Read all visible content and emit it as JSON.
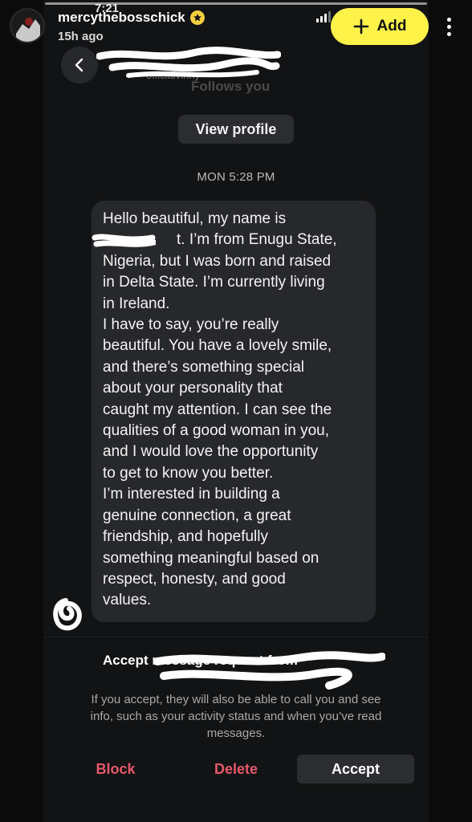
{
  "story_header": {
    "username": "mercythebosschick",
    "posted_ago": "15h ago",
    "status_time": "7:21",
    "add_label": "Add"
  },
  "dm": {
    "handle_partial": "officialvinny",
    "follows_text": "Follows you",
    "view_profile_label": "View profile",
    "timestamp": "MON 5:28 PM",
    "message_lines": [
      "Hello beautiful, my name is",
      "t. I’m from Enugu State,",
      "Nigeria, but I was born and raised",
      "in Delta State. I’m currently living",
      "in Ireland.",
      "I have to say, you’re really",
      "beautiful. You have a lovely smile,",
      "and there’s something special",
      "about your personality that",
      "caught my attention. I can see the",
      "qualities of a good woman in you,",
      "and I would love the opportunity",
      "to get to know you better.",
      "I’m interested in building a",
      "genuine connection, a great",
      "friendship, and hopefully",
      "something meaningful based on",
      "respect, honesty, and good",
      "values."
    ]
  },
  "request": {
    "title": "Accept message request from",
    "info_lines": [
      "If you accept, they will also be able to call you and see",
      "info, such as your activity status and when you’ve read",
      "messages."
    ],
    "block_label": "Block",
    "delete_label": "Delete",
    "accept_label": "Accept"
  },
  "colors": {
    "add_button": "#fff34a",
    "danger_text": "#e5586a",
    "bubble": "#26282b"
  }
}
